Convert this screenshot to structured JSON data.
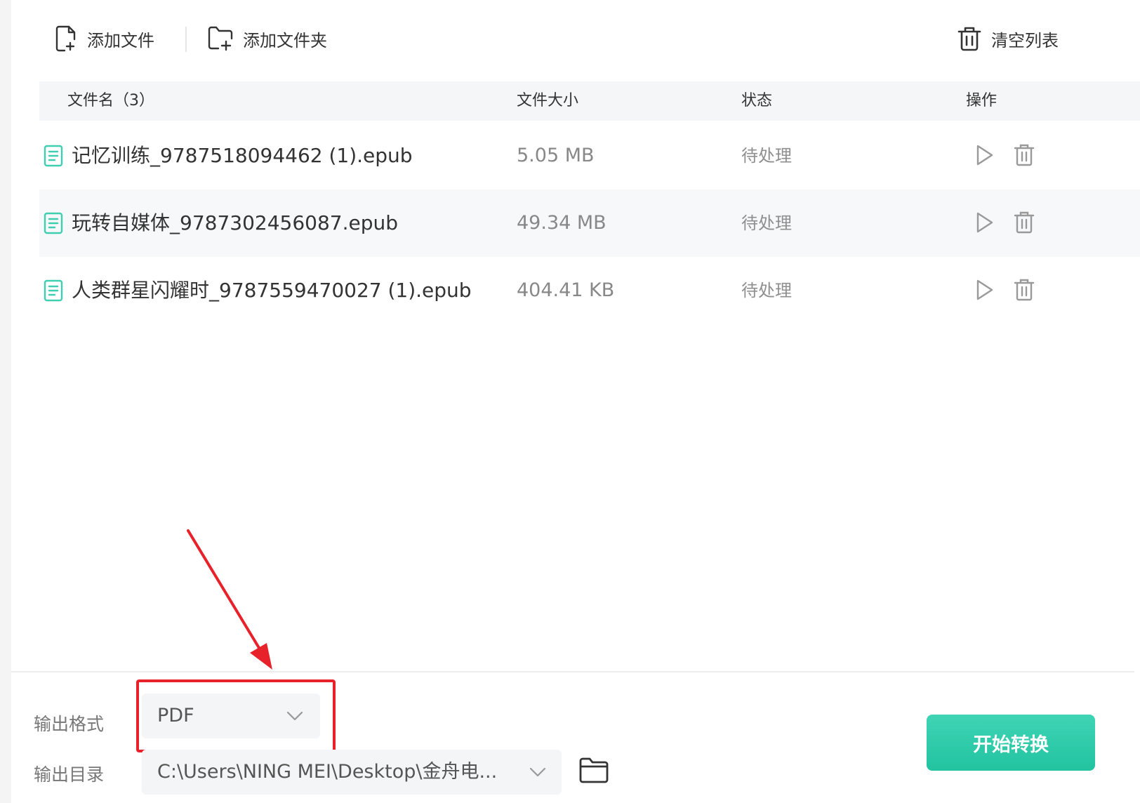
{
  "toolbar": {
    "add_file": "添加文件",
    "add_folder": "添加文件夹",
    "clear_list": "清空列表"
  },
  "table": {
    "headers": {
      "name": "文件名（3）",
      "size": "文件大小",
      "status": "状态",
      "action": "操作"
    },
    "rows": [
      {
        "name": "记忆训练_9787518094462 (1).epub",
        "size": "5.05 MB",
        "status": "待处理"
      },
      {
        "name": "玩转自媒体_9787302456087.epub",
        "size": "49.34 MB",
        "status": "待处理"
      },
      {
        "name": "人类群星闪耀时_9787559470027 (1).epub",
        "size": "404.41 KB",
        "status": "待处理"
      }
    ]
  },
  "output": {
    "format_label": "输出格式",
    "format_value": "PDF",
    "dir_label": "输出目录",
    "dir_value": "C:\\Users\\NING MEI\\Desktop\\金舟电..."
  },
  "start_button": "开始转换",
  "colors": {
    "accent": "#22c3a0",
    "highlight": "#e8222a",
    "file_icon": "#3fcfb0"
  },
  "icons": {
    "add_file": "add-file-icon",
    "add_folder": "add-folder-icon",
    "clear": "trash-icon",
    "file": "document-icon",
    "play": "play-icon",
    "delete": "trash-icon",
    "chevron": "chevron-down-icon",
    "folder": "folder-icon"
  }
}
